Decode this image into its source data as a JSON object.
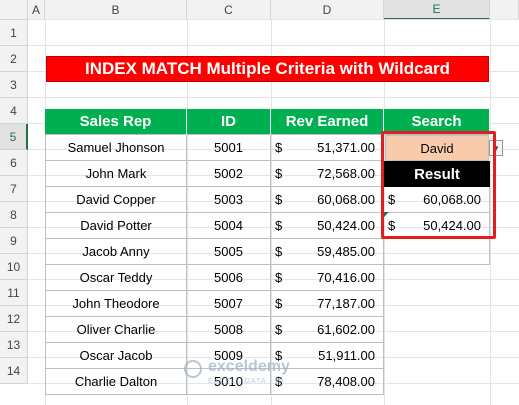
{
  "columns": [
    "A",
    "B",
    "C",
    "D",
    "E"
  ],
  "rows": [
    "1",
    "2",
    "3",
    "4",
    "5",
    "6",
    "7",
    "8",
    "9",
    "10",
    "11",
    "12",
    "13",
    "14"
  ],
  "title": "INDEX MATCH Multiple Criteria with Wildcard",
  "headers": {
    "sales_rep": "Sales Rep",
    "id": "ID",
    "rev": "Rev Earned",
    "search": "Search"
  },
  "table": [
    {
      "name": "Samuel Jhonson",
      "id": "5001",
      "cur": "$",
      "rev": "51,371.00"
    },
    {
      "name": "John Mark",
      "id": "5002",
      "cur": "$",
      "rev": "72,568.00"
    },
    {
      "name": "David Copper",
      "id": "5003",
      "cur": "$",
      "rev": "60,068.00"
    },
    {
      "name": "David Potter",
      "id": "5004",
      "cur": "$",
      "rev": "50,424.00"
    },
    {
      "name": "Jacob Anny",
      "id": "5005",
      "cur": "$",
      "rev": "59,485.00"
    },
    {
      "name": "Oscar Teddy",
      "id": "5006",
      "cur": "$",
      "rev": "70,416.00"
    },
    {
      "name": "John Theodore",
      "id": "5007",
      "cur": "$",
      "rev": "77,187.00"
    },
    {
      "name": "Oliver Charlie",
      "id": "5008",
      "cur": "$",
      "rev": "61,602.00"
    },
    {
      "name": "Oscar Jacob",
      "id": "5009",
      "cur": "$",
      "rev": "51,911.00"
    },
    {
      "name": "Charlie Dalton",
      "id": "5010",
      "cur": "$",
      "rev": "78,408.00"
    }
  ],
  "search": {
    "value": "David",
    "dropdown_icon": "▼"
  },
  "result": {
    "label": "Result",
    "values": [
      {
        "cur": "$",
        "amt": "60,068.00"
      },
      {
        "cur": "$",
        "amt": "50,424.00"
      }
    ]
  },
  "watermark": {
    "name": "exceldemy",
    "tagline": "EXCEL · DATA · BI"
  },
  "colors": {
    "title_bg": "#ff0000",
    "header_bg": "#00b050",
    "search_bg": "#f8cbad",
    "result_bg": "#000000",
    "highlight": "#e02020",
    "selected": "#217346"
  }
}
